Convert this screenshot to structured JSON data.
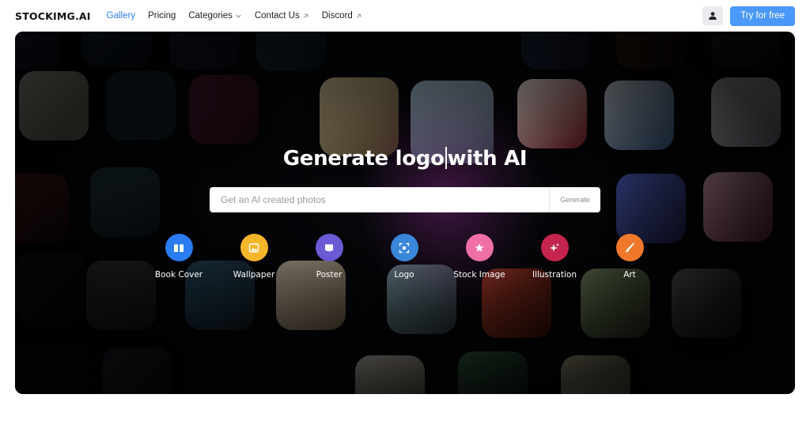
{
  "nav": {
    "brand": "STOCKIMG.AI",
    "links": [
      {
        "label": "Gallery"
      },
      {
        "label": "Pricing"
      },
      {
        "label": "Categories"
      },
      {
        "label": "Contact Us"
      },
      {
        "label": "Discord"
      }
    ],
    "try_label": "Try for free"
  },
  "hero": {
    "headline_part1": "Generate logo",
    "headline_part2": "with AI",
    "search_placeholder": "Get an AI created photos",
    "generate_label": "Generate",
    "categories": [
      {
        "label": "Book Cover",
        "color": "#2b7cf0",
        "icon": "book-icon"
      },
      {
        "label": "Wallpaper",
        "color": "#f5b62a",
        "icon": "image-icon"
      },
      {
        "label": "Poster",
        "color": "#6a5ad3",
        "icon": "flag-icon"
      },
      {
        "label": "Logo",
        "color": "#3a86d8",
        "icon": "focus-icon"
      },
      {
        "label": "Stock Image",
        "color": "#ef6fa6",
        "icon": "star-icon"
      },
      {
        "label": "Illustration",
        "color": "#c4244d",
        "icon": "sparkle-icon"
      },
      {
        "label": "Art",
        "color": "#f0782a",
        "icon": "brush-icon"
      }
    ]
  },
  "colors": {
    "accent": "#2f7df6",
    "try_button": "#4a98f8",
    "hero_bg": "#07080c"
  }
}
